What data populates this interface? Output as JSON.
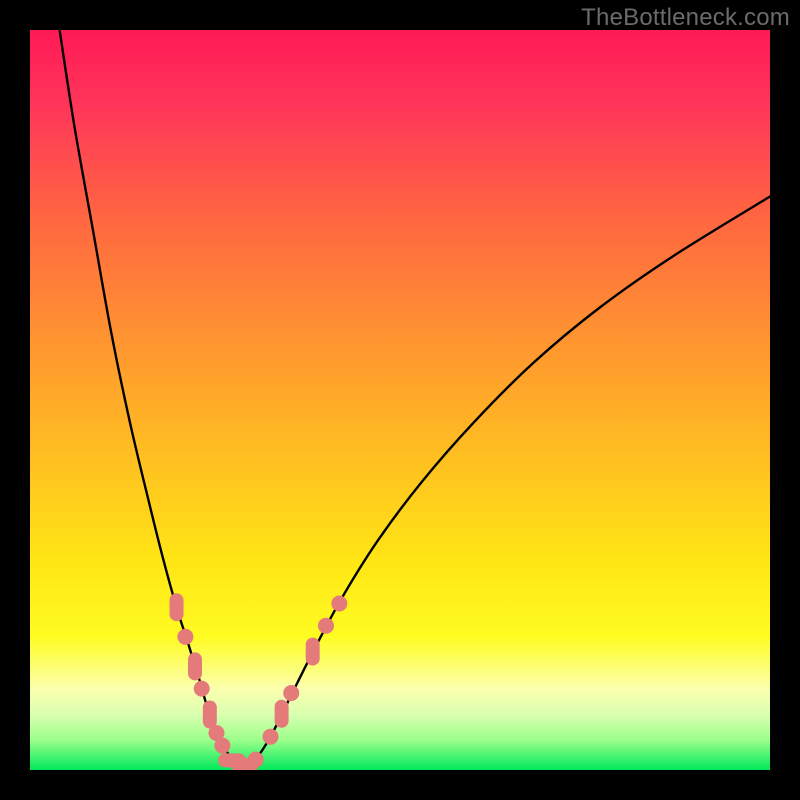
{
  "watermark": "TheBottleneck.com",
  "colors": {
    "frame": "#000000",
    "curve": "#000000",
    "marker_fill": "#e47a7a",
    "marker_stroke": "#d96a6a"
  },
  "chart_data": {
    "type": "line",
    "title": "",
    "xlabel": "",
    "ylabel": "",
    "xlim": [
      0,
      100
    ],
    "ylim": [
      0,
      100
    ],
    "grid": false,
    "note": "Axes are unlabeled; values below are estimated relative positions (0–100) in plot space, y=0 at bottom.",
    "series": [
      {
        "name": "left-branch",
        "x": [
          4.0,
          6.0,
          8.5,
          11.0,
          13.5,
          16.0,
          18.0,
          19.8,
          21.4,
          22.8,
          23.8,
          24.8,
          26.0,
          27.5,
          29.0
        ],
        "y": [
          100.0,
          87.0,
          73.0,
          59.0,
          47.0,
          36.5,
          28.5,
          22.0,
          17.0,
          12.5,
          9.0,
          6.0,
          3.5,
          1.2,
          0.5
        ]
      },
      {
        "name": "right-branch",
        "x": [
          29.0,
          30.5,
          32.5,
          35.0,
          38.0,
          42.0,
          47.0,
          53.0,
          60.0,
          68.0,
          77.0,
          87.0,
          100.0
        ],
        "y": [
          0.5,
          1.5,
          4.5,
          9.5,
          15.5,
          23.0,
          31.0,
          39.0,
          47.0,
          55.0,
          62.5,
          69.5,
          77.5
        ]
      }
    ],
    "markers": {
      "name": "highlighted-points",
      "note": "Pill/round pink markers clustered near the valley",
      "points": [
        {
          "x": 19.8,
          "y": 22.0,
          "shape": "pill-v"
        },
        {
          "x": 21.0,
          "y": 18.0,
          "shape": "round"
        },
        {
          "x": 22.3,
          "y": 14.0,
          "shape": "pill-v"
        },
        {
          "x": 23.2,
          "y": 11.0,
          "shape": "round"
        },
        {
          "x": 24.3,
          "y": 7.5,
          "shape": "pill-v"
        },
        {
          "x": 25.2,
          "y": 5.0,
          "shape": "round"
        },
        {
          "x": 26.0,
          "y": 3.3,
          "shape": "round"
        },
        {
          "x": 27.3,
          "y": 1.3,
          "shape": "pill-h"
        },
        {
          "x": 29.0,
          "y": 0.7,
          "shape": "pill-h"
        },
        {
          "x": 30.5,
          "y": 1.4,
          "shape": "round"
        },
        {
          "x": 32.5,
          "y": 4.5,
          "shape": "round"
        },
        {
          "x": 34.0,
          "y": 7.6,
          "shape": "pill-v"
        },
        {
          "x": 35.3,
          "y": 10.4,
          "shape": "round"
        },
        {
          "x": 38.2,
          "y": 16.0,
          "shape": "pill-v"
        },
        {
          "x": 40.0,
          "y": 19.5,
          "shape": "round"
        },
        {
          "x": 41.8,
          "y": 22.5,
          "shape": "round"
        }
      ]
    }
  }
}
